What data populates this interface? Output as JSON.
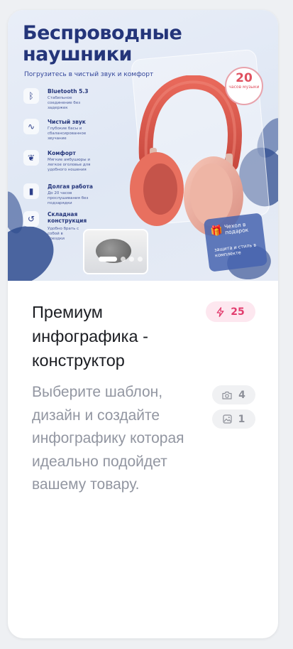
{
  "card": {
    "image": {
      "heading": "Беспроводные наушники",
      "subheading": "Погрузитесь в чистый звук и комфорт",
      "features": [
        {
          "title": "Bluetooth 5.3",
          "desc": "Стабильное соединение без задержек",
          "icon": "bluetooth-icon"
        },
        {
          "title": "Чистый звук",
          "desc": "Глубокие басы и сбалансированное звучание",
          "icon": "sound-wave-icon"
        },
        {
          "title": "Комфорт",
          "desc": "Мягкие амбушюры и легкое оголовье для удобного ношения",
          "icon": "leaf-icon"
        },
        {
          "title": "Долгая работа",
          "desc": "До 20 часов прослушивания без подзарядки",
          "icon": "battery-icon"
        },
        {
          "title": "Складная конструкция",
          "desc": "Удобно брать с собой в поездки",
          "icon": "fold-icon"
        }
      ],
      "badge_number": "20",
      "badge_text": "часов музыки",
      "gift_title": "Чехол в подарок",
      "gift_sub": "защита и стиль в комплекте",
      "slides_total": 4,
      "slide_active": 1
    },
    "title": "Премиум инфографика - конструктор",
    "description": "Выберите шаблон, дизайн и создайте инфографику которая идеально подойдет вашему товару.",
    "price": "25",
    "photo_count": "4",
    "image_count": "1"
  },
  "colors": {
    "accent_pink": "#e23d6e",
    "pink_bg": "#fde7ef",
    "hero_blue": "#24357a",
    "muted_text": "#9296a1"
  }
}
